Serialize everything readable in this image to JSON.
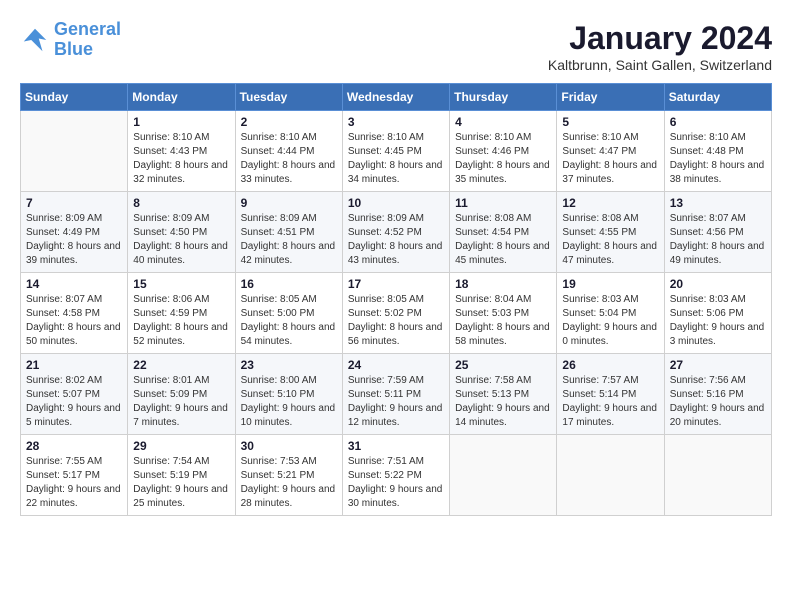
{
  "header": {
    "logo_line1": "General",
    "logo_line2": "Blue",
    "month": "January 2024",
    "location": "Kaltbrunn, Saint Gallen, Switzerland"
  },
  "days_of_week": [
    "Sunday",
    "Monday",
    "Tuesday",
    "Wednesday",
    "Thursday",
    "Friday",
    "Saturday"
  ],
  "weeks": [
    [
      {
        "day": "",
        "sunrise": "",
        "sunset": "",
        "daylight": ""
      },
      {
        "day": "1",
        "sunrise": "Sunrise: 8:10 AM",
        "sunset": "Sunset: 4:43 PM",
        "daylight": "Daylight: 8 hours and 32 minutes."
      },
      {
        "day": "2",
        "sunrise": "Sunrise: 8:10 AM",
        "sunset": "Sunset: 4:44 PM",
        "daylight": "Daylight: 8 hours and 33 minutes."
      },
      {
        "day": "3",
        "sunrise": "Sunrise: 8:10 AM",
        "sunset": "Sunset: 4:45 PM",
        "daylight": "Daylight: 8 hours and 34 minutes."
      },
      {
        "day": "4",
        "sunrise": "Sunrise: 8:10 AM",
        "sunset": "Sunset: 4:46 PM",
        "daylight": "Daylight: 8 hours and 35 minutes."
      },
      {
        "day": "5",
        "sunrise": "Sunrise: 8:10 AM",
        "sunset": "Sunset: 4:47 PM",
        "daylight": "Daylight: 8 hours and 37 minutes."
      },
      {
        "day": "6",
        "sunrise": "Sunrise: 8:10 AM",
        "sunset": "Sunset: 4:48 PM",
        "daylight": "Daylight: 8 hours and 38 minutes."
      }
    ],
    [
      {
        "day": "7",
        "sunrise": "Sunrise: 8:09 AM",
        "sunset": "Sunset: 4:49 PM",
        "daylight": "Daylight: 8 hours and 39 minutes."
      },
      {
        "day": "8",
        "sunrise": "Sunrise: 8:09 AM",
        "sunset": "Sunset: 4:50 PM",
        "daylight": "Daylight: 8 hours and 40 minutes."
      },
      {
        "day": "9",
        "sunrise": "Sunrise: 8:09 AM",
        "sunset": "Sunset: 4:51 PM",
        "daylight": "Daylight: 8 hours and 42 minutes."
      },
      {
        "day": "10",
        "sunrise": "Sunrise: 8:09 AM",
        "sunset": "Sunset: 4:52 PM",
        "daylight": "Daylight: 8 hours and 43 minutes."
      },
      {
        "day": "11",
        "sunrise": "Sunrise: 8:08 AM",
        "sunset": "Sunset: 4:54 PM",
        "daylight": "Daylight: 8 hours and 45 minutes."
      },
      {
        "day": "12",
        "sunrise": "Sunrise: 8:08 AM",
        "sunset": "Sunset: 4:55 PM",
        "daylight": "Daylight: 8 hours and 47 minutes."
      },
      {
        "day": "13",
        "sunrise": "Sunrise: 8:07 AM",
        "sunset": "Sunset: 4:56 PM",
        "daylight": "Daylight: 8 hours and 49 minutes."
      }
    ],
    [
      {
        "day": "14",
        "sunrise": "Sunrise: 8:07 AM",
        "sunset": "Sunset: 4:58 PM",
        "daylight": "Daylight: 8 hours and 50 minutes."
      },
      {
        "day": "15",
        "sunrise": "Sunrise: 8:06 AM",
        "sunset": "Sunset: 4:59 PM",
        "daylight": "Daylight: 8 hours and 52 minutes."
      },
      {
        "day": "16",
        "sunrise": "Sunrise: 8:05 AM",
        "sunset": "Sunset: 5:00 PM",
        "daylight": "Daylight: 8 hours and 54 minutes."
      },
      {
        "day": "17",
        "sunrise": "Sunrise: 8:05 AM",
        "sunset": "Sunset: 5:02 PM",
        "daylight": "Daylight: 8 hours and 56 minutes."
      },
      {
        "day": "18",
        "sunrise": "Sunrise: 8:04 AM",
        "sunset": "Sunset: 5:03 PM",
        "daylight": "Daylight: 8 hours and 58 minutes."
      },
      {
        "day": "19",
        "sunrise": "Sunrise: 8:03 AM",
        "sunset": "Sunset: 5:04 PM",
        "daylight": "Daylight: 9 hours and 0 minutes."
      },
      {
        "day": "20",
        "sunrise": "Sunrise: 8:03 AM",
        "sunset": "Sunset: 5:06 PM",
        "daylight": "Daylight: 9 hours and 3 minutes."
      }
    ],
    [
      {
        "day": "21",
        "sunrise": "Sunrise: 8:02 AM",
        "sunset": "Sunset: 5:07 PM",
        "daylight": "Daylight: 9 hours and 5 minutes."
      },
      {
        "day": "22",
        "sunrise": "Sunrise: 8:01 AM",
        "sunset": "Sunset: 5:09 PM",
        "daylight": "Daylight: 9 hours and 7 minutes."
      },
      {
        "day": "23",
        "sunrise": "Sunrise: 8:00 AM",
        "sunset": "Sunset: 5:10 PM",
        "daylight": "Daylight: 9 hours and 10 minutes."
      },
      {
        "day": "24",
        "sunrise": "Sunrise: 7:59 AM",
        "sunset": "Sunset: 5:11 PM",
        "daylight": "Daylight: 9 hours and 12 minutes."
      },
      {
        "day": "25",
        "sunrise": "Sunrise: 7:58 AM",
        "sunset": "Sunset: 5:13 PM",
        "daylight": "Daylight: 9 hours and 14 minutes."
      },
      {
        "day": "26",
        "sunrise": "Sunrise: 7:57 AM",
        "sunset": "Sunset: 5:14 PM",
        "daylight": "Daylight: 9 hours and 17 minutes."
      },
      {
        "day": "27",
        "sunrise": "Sunrise: 7:56 AM",
        "sunset": "Sunset: 5:16 PM",
        "daylight": "Daylight: 9 hours and 20 minutes."
      }
    ],
    [
      {
        "day": "28",
        "sunrise": "Sunrise: 7:55 AM",
        "sunset": "Sunset: 5:17 PM",
        "daylight": "Daylight: 9 hours and 22 minutes."
      },
      {
        "day": "29",
        "sunrise": "Sunrise: 7:54 AM",
        "sunset": "Sunset: 5:19 PM",
        "daylight": "Daylight: 9 hours and 25 minutes."
      },
      {
        "day": "30",
        "sunrise": "Sunrise: 7:53 AM",
        "sunset": "Sunset: 5:21 PM",
        "daylight": "Daylight: 9 hours and 28 minutes."
      },
      {
        "day": "31",
        "sunrise": "Sunrise: 7:51 AM",
        "sunset": "Sunset: 5:22 PM",
        "daylight": "Daylight: 9 hours and 30 minutes."
      },
      {
        "day": "",
        "sunrise": "",
        "sunset": "",
        "daylight": ""
      },
      {
        "day": "",
        "sunrise": "",
        "sunset": "",
        "daylight": ""
      },
      {
        "day": "",
        "sunrise": "",
        "sunset": "",
        "daylight": ""
      }
    ]
  ]
}
